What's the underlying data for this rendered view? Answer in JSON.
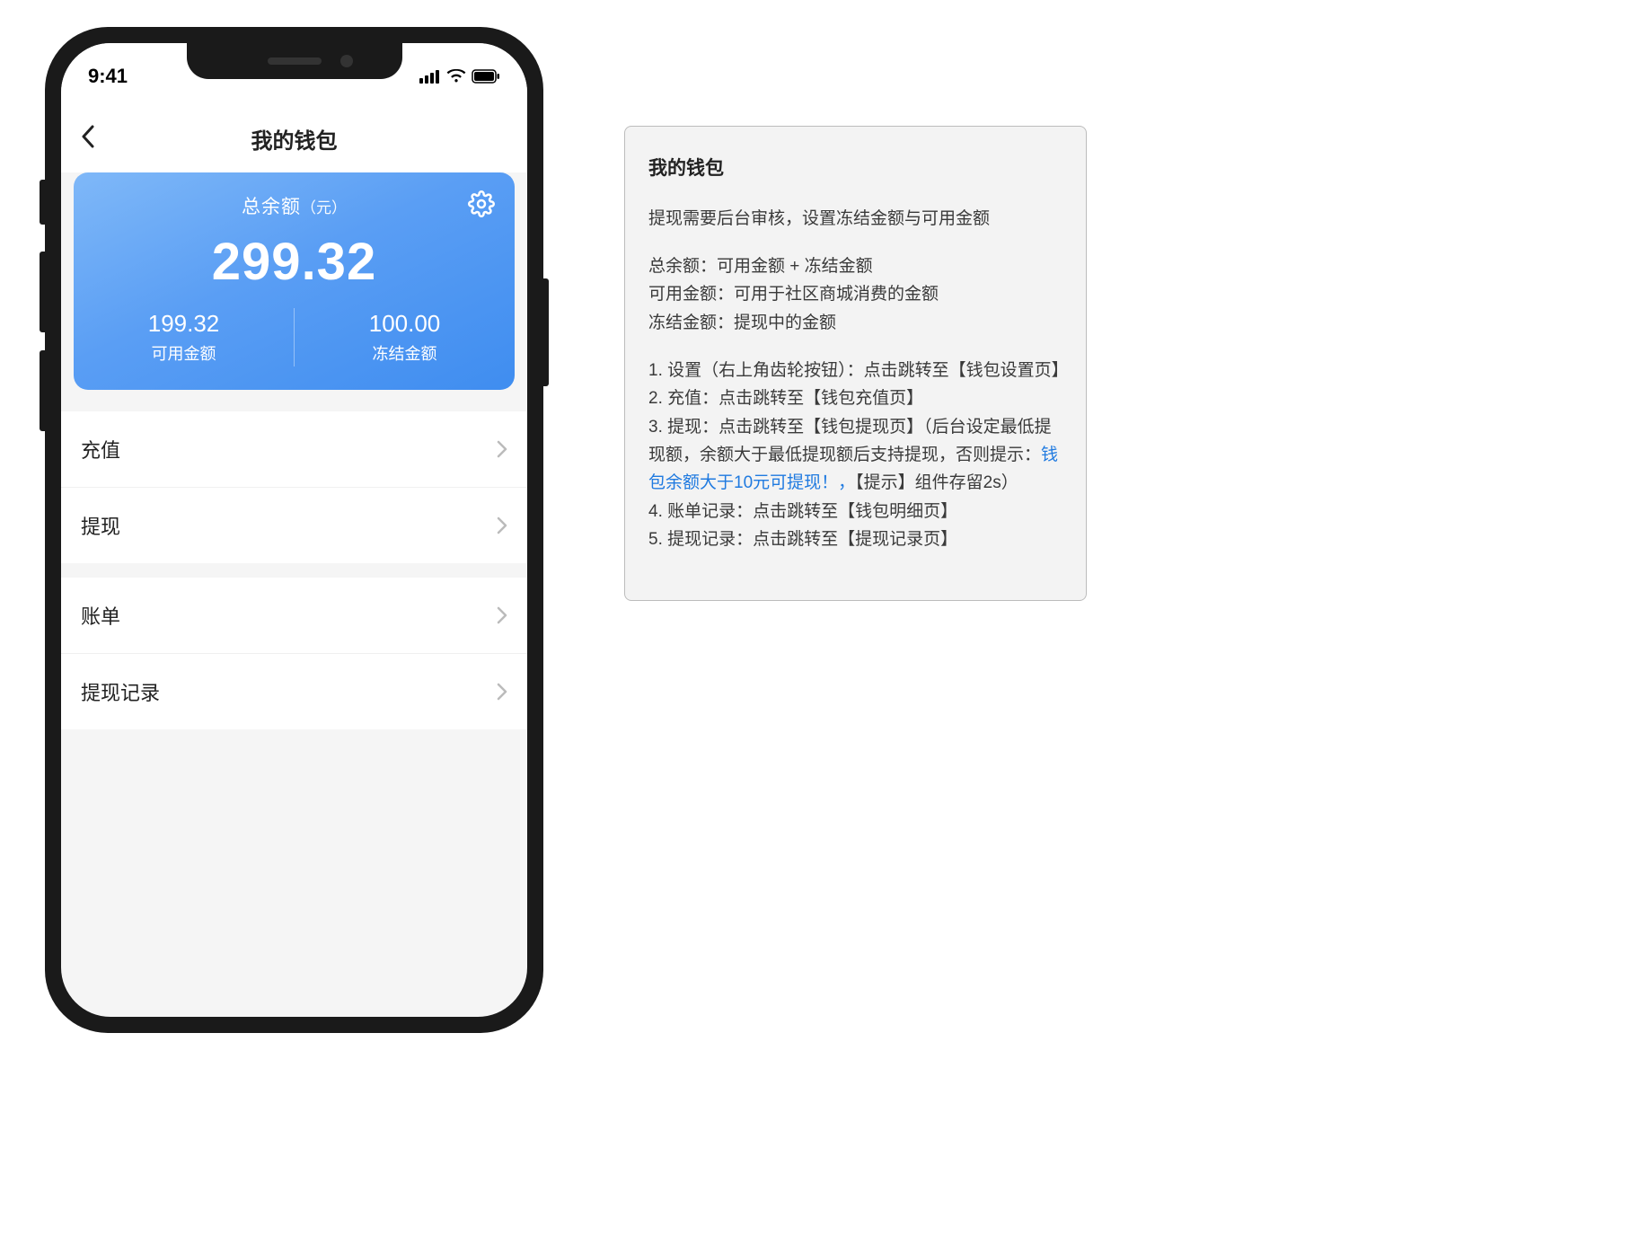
{
  "status": {
    "time": "9:41"
  },
  "nav": {
    "title": "我的钱包"
  },
  "balance": {
    "title": "总余额",
    "unit": "（元）",
    "total": "299.32",
    "available": {
      "value": "199.32",
      "label": "可用金额"
    },
    "frozen": {
      "value": "100.00",
      "label": "冻结金额"
    }
  },
  "menu": {
    "recharge": "充值",
    "withdraw": "提现",
    "bill": "账单",
    "withdraw_log": "提现记录"
  },
  "spec": {
    "title": "我的钱包",
    "subtitle": "提现需要后台审核，设置冻结金额与可用金额",
    "line1": "总余额：可用金额 + 冻结金额",
    "line2": "可用金额：可用于社区商城消费的金额",
    "line3": "冻结金额：提现中的金额",
    "b1": "1. 设置（右上角齿轮按钮）：点击跳转至【钱包设置页】",
    "b2": "2. 充值：点击跳转至【钱包充值页】",
    "b3a": "3. 提现：点击跳转至【钱包提现页】（后台设定最低提现额，余额大于最低提现额后支持提现，否则提示：",
    "b3_link": "钱包余额大于10元可提现！，",
    "b3b": "【提示】组件存留2s）",
    "b4": "4. 账单记录：点击跳转至【钱包明细页】",
    "b5": "5. 提现记录：点击跳转至【提现记录页】"
  }
}
